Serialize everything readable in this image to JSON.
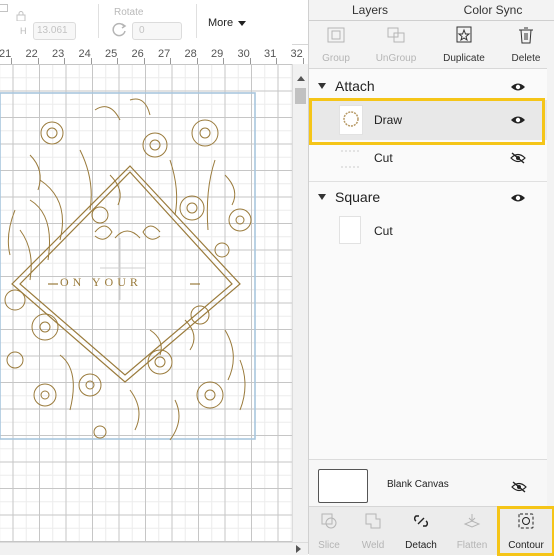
{
  "toolbar": {
    "h_label": "H",
    "h_value": "13.061",
    "rotate_label": "Rotate",
    "rotate_value": "0",
    "more_label": "More"
  },
  "ruler": {
    "ticks": [
      "21",
      "22",
      "23",
      "24",
      "25",
      "26",
      "27",
      "28",
      "29",
      "30",
      "31",
      "32"
    ]
  },
  "design": {
    "text": "ON YOUR"
  },
  "panel": {
    "tabs": [
      {
        "label": "Layers"
      },
      {
        "label": "Color Sync"
      }
    ],
    "actions": {
      "group": "Group",
      "ungroup": "UnGroup",
      "duplicate": "Duplicate",
      "delete": "Delete"
    },
    "groups": [
      {
        "name": "Attach",
        "layers": [
          {
            "label": "Draw"
          },
          {
            "label": "Cut"
          }
        ]
      },
      {
        "name": "Square",
        "layers": [
          {
            "label": "Cut"
          }
        ]
      }
    ],
    "canvas_label": "Blank Canvas",
    "bottom_tools": {
      "slice": "Slice",
      "weld": "Weld",
      "detach": "Detach",
      "flatten": "Flatten",
      "contour": "Contour"
    }
  },
  "colors": {
    "highlight": "#f5c518",
    "design_line": "#9a7b3c",
    "selection": "#a9c6de"
  }
}
